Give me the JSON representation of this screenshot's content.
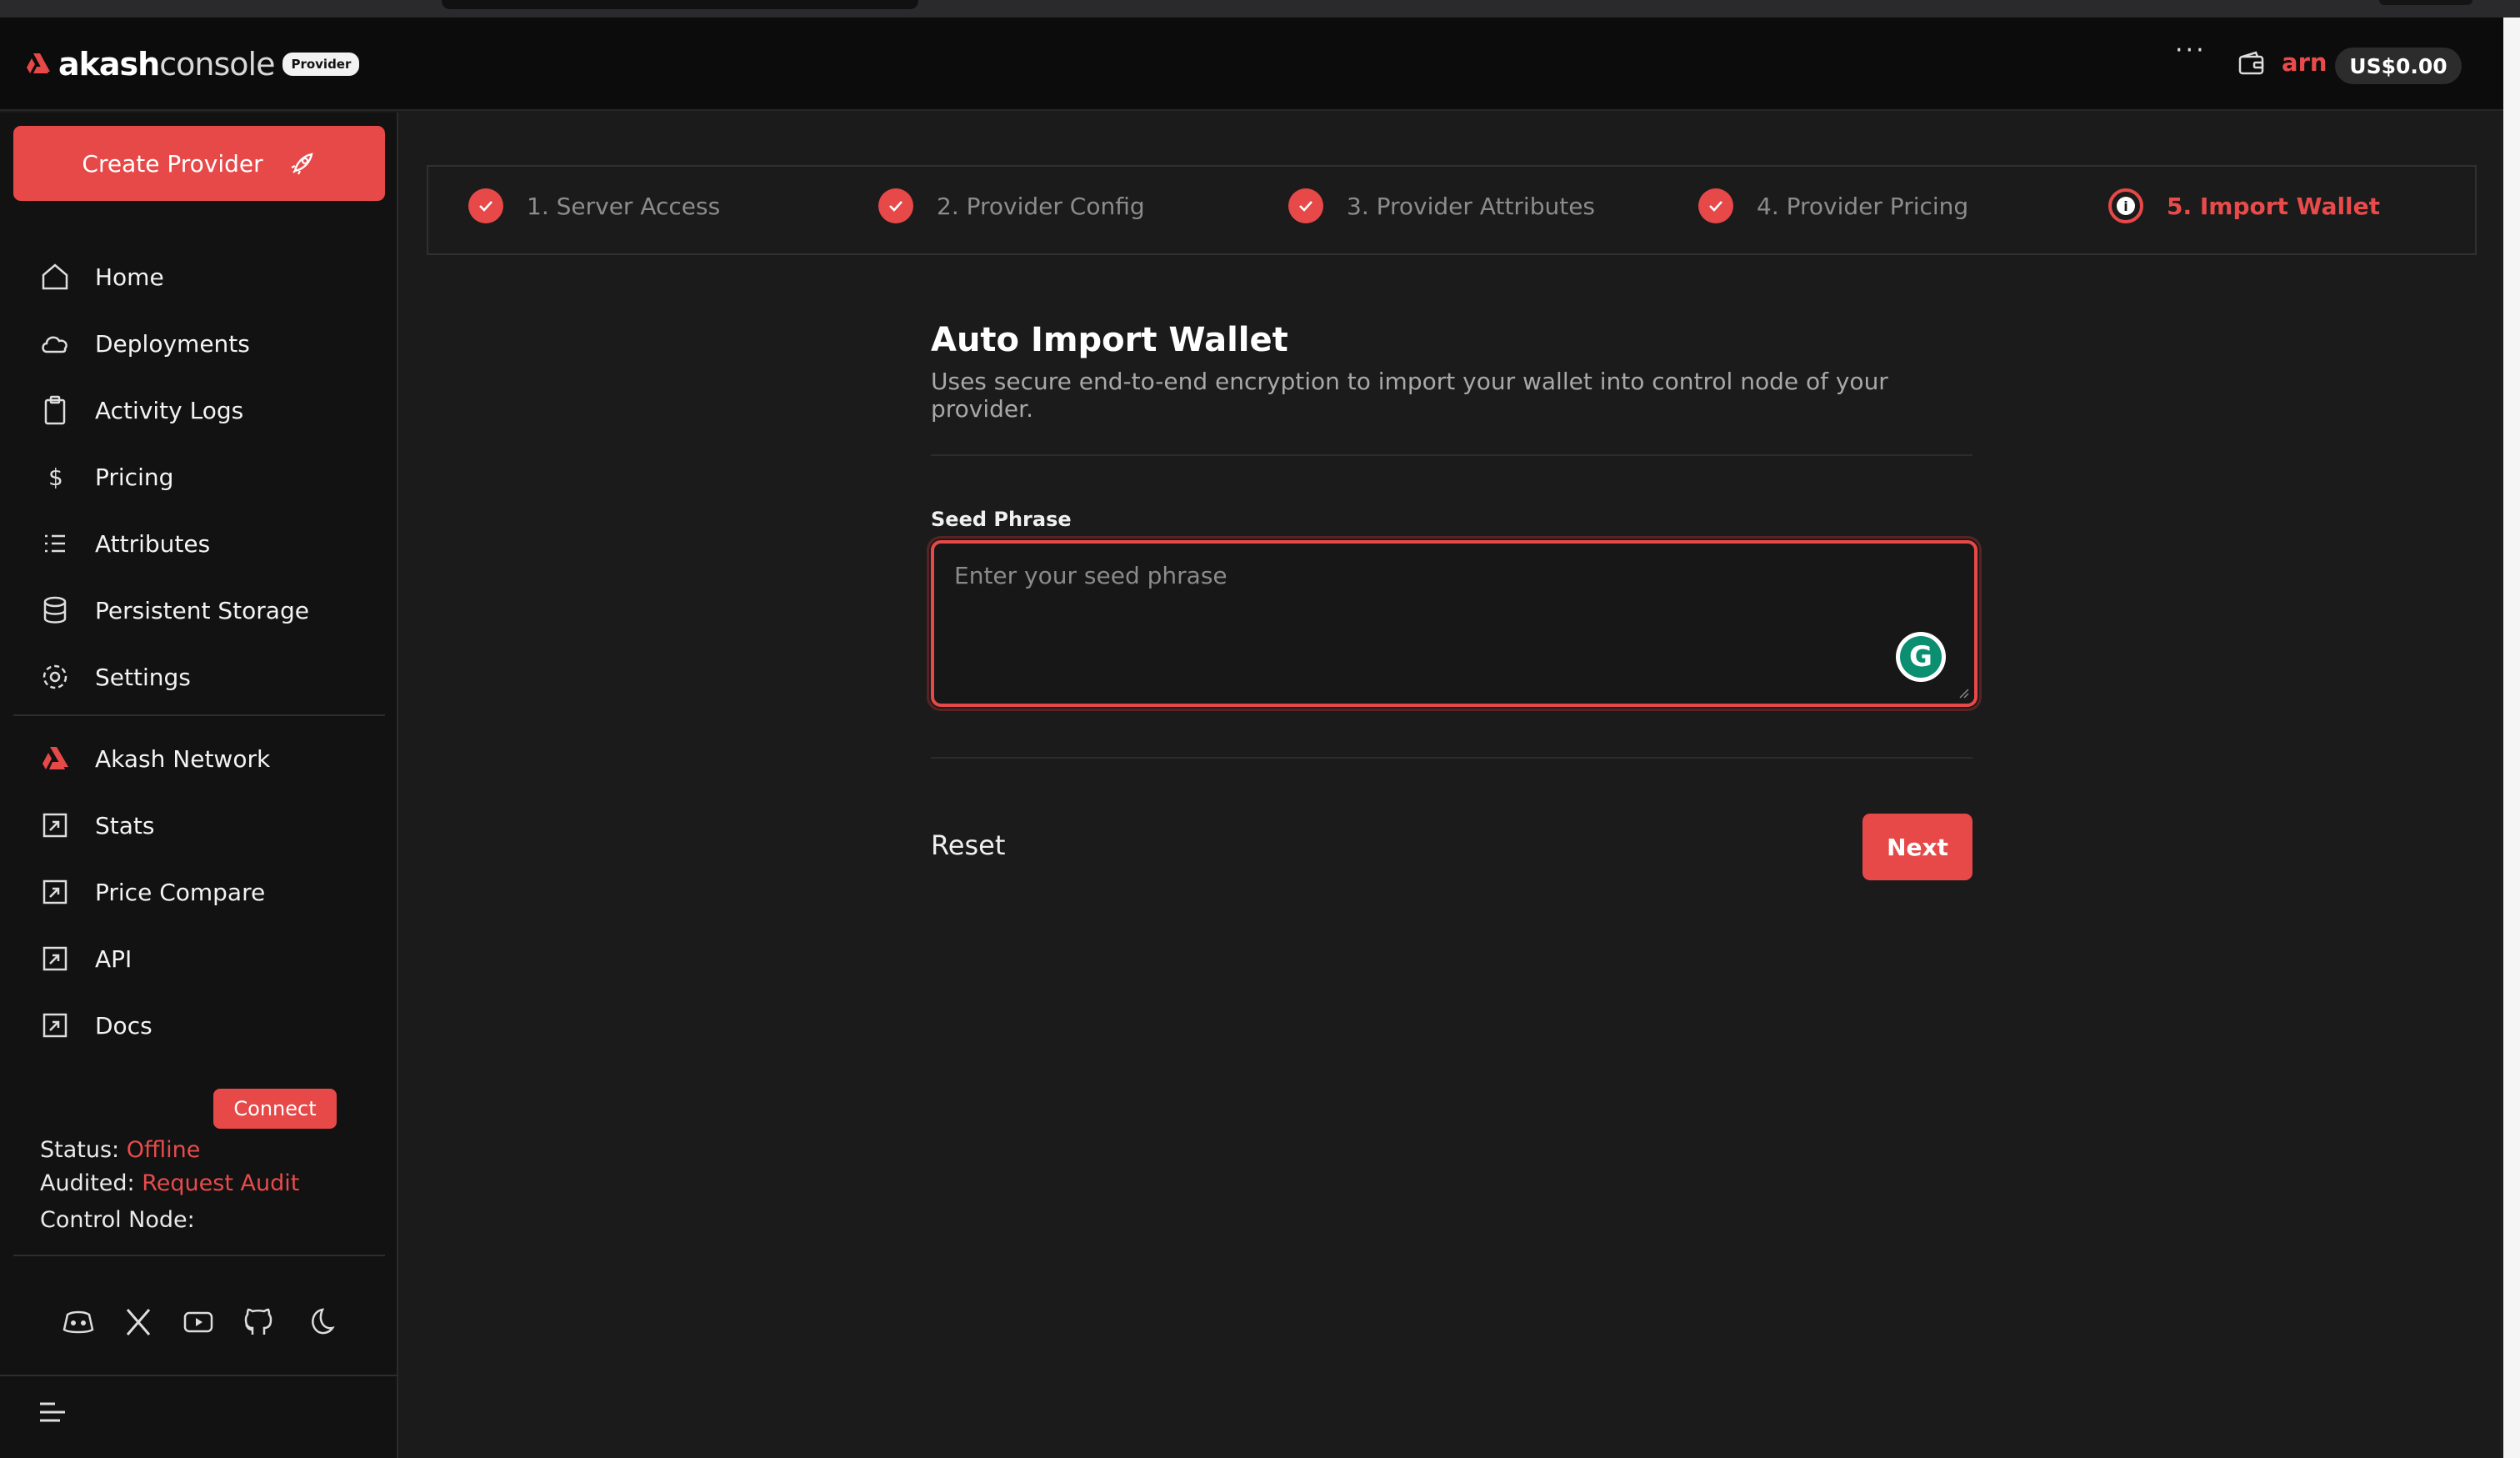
{
  "header": {
    "logo_main": "akash",
    "logo_sub": "console",
    "logo_badge": "Provider",
    "more_label": "···",
    "account": "arn",
    "balance": "US$0.00"
  },
  "sidebar": {
    "create_label": "Create Provider",
    "items": [
      {
        "label": "Home",
        "icon": "home-icon"
      },
      {
        "label": "Deployments",
        "icon": "cloud-icon"
      },
      {
        "label": "Activity Logs",
        "icon": "clipboard-icon"
      },
      {
        "label": "Pricing",
        "icon": "dollar-icon"
      },
      {
        "label": "Attributes",
        "icon": "list-icon"
      },
      {
        "label": "Persistent Storage",
        "icon": "database-icon"
      },
      {
        "label": "Settings",
        "icon": "gear-icon"
      }
    ],
    "external": [
      {
        "label": "Akash Network",
        "icon": "akash-logo-icon"
      },
      {
        "label": "Stats",
        "icon": "external-link-icon"
      },
      {
        "label": "Price Compare",
        "icon": "external-link-icon"
      },
      {
        "label": "API",
        "icon": "external-link-icon"
      },
      {
        "label": "Docs",
        "icon": "external-link-icon"
      }
    ],
    "status_label": "Status:",
    "status_value": "Offline",
    "audited_label": "Audited:",
    "audited_value": "Request Audit",
    "control_label": "Control Node:",
    "connect_label": "Connect",
    "social": [
      "discord-icon",
      "x-icon",
      "youtube-icon",
      "github-icon",
      "moon-icon"
    ]
  },
  "stepper": {
    "steps": [
      {
        "label": "1. Server Access",
        "state": "done"
      },
      {
        "label": "2. Provider Config",
        "state": "done"
      },
      {
        "label": "3. Provider Attributes",
        "state": "done"
      },
      {
        "label": "4. Provider Pricing",
        "state": "done"
      },
      {
        "label": "5. Import Wallet",
        "state": "active"
      }
    ]
  },
  "form": {
    "title": "Auto Import Wallet",
    "subtitle": "Uses secure end-to-end encryption to import your wallet into control node of your provider.",
    "seed_label": "Seed Phrase",
    "seed_placeholder": "Enter your seed phrase",
    "seed_value": "",
    "reset_label": "Reset",
    "next_label": "Next"
  },
  "colors": {
    "accent": "#e74848",
    "background": "#1b1b1b",
    "sidebar": "#121212"
  }
}
